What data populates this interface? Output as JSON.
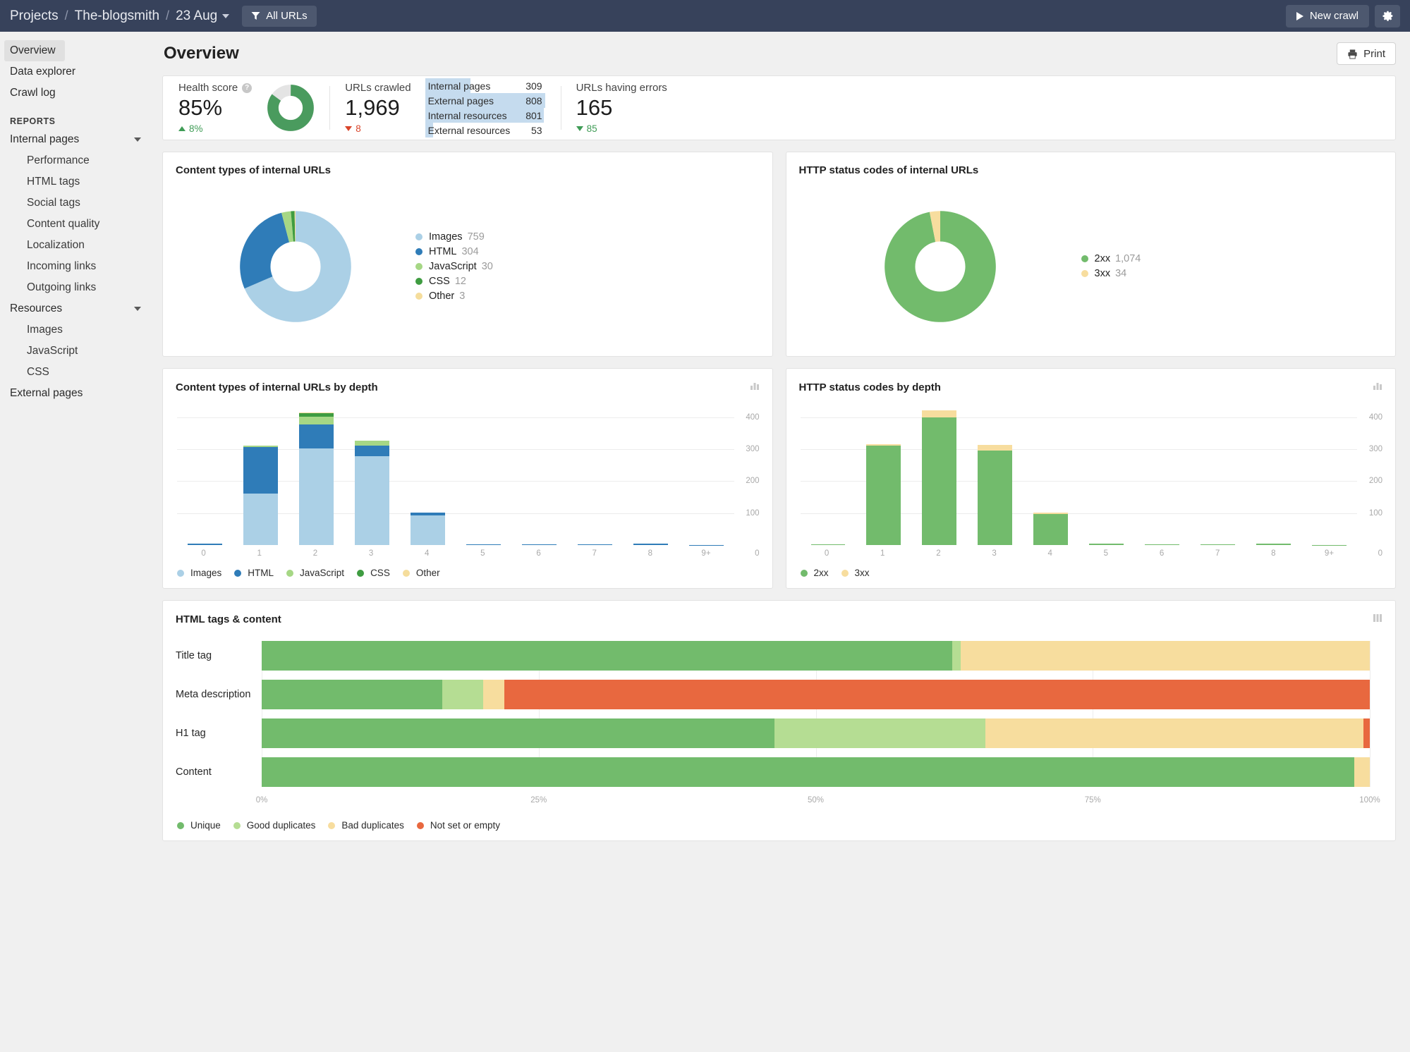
{
  "topbar": {
    "breadcrumbs": [
      "Projects",
      "The-blogsmith",
      "23 Aug"
    ],
    "filter_label": "All URLs",
    "new_crawl_label": "New crawl",
    "settings_icon": "gear-icon",
    "filter_icon": "funnel-icon",
    "play_icon": "play-icon"
  },
  "sidebar": {
    "top_items": [
      {
        "label": "Overview",
        "active": true
      },
      {
        "label": "Data explorer",
        "active": false
      },
      {
        "label": "Crawl log",
        "active": false
      }
    ],
    "section_label": "REPORTS",
    "groups": [
      {
        "label": "Internal pages",
        "expandable": true,
        "children": [
          {
            "label": "Performance"
          },
          {
            "label": "HTML tags"
          },
          {
            "label": "Social tags"
          },
          {
            "label": "Content quality"
          },
          {
            "label": "Localization"
          },
          {
            "label": "Incoming links"
          },
          {
            "label": "Outgoing links"
          }
        ]
      },
      {
        "label": "Resources",
        "expandable": true,
        "children": [
          {
            "label": "Images"
          },
          {
            "label": "JavaScript"
          },
          {
            "label": "CSS"
          }
        ]
      }
    ],
    "bottom_items": [
      {
        "label": "External pages"
      }
    ]
  },
  "page": {
    "title": "Overview",
    "print_label": "Print",
    "print_icon": "printer-icon"
  },
  "kpis": {
    "health": {
      "label": "Health score",
      "help_icon": "question-mark-icon",
      "value": "85%",
      "delta": "8%",
      "delta_dir": "up",
      "percent": 85,
      "color": "#4a9b5e",
      "track": "#e4e4e4"
    },
    "crawled": {
      "label": "URLs crawled",
      "value": "1,969",
      "delta": "8",
      "delta_dir": "down",
      "breakdown": [
        {
          "label": "Internal pages",
          "value": "309",
          "pct": 38
        },
        {
          "label": "External pages",
          "value": "808",
          "pct": 100
        },
        {
          "label": "Internal resources",
          "value": "801",
          "pct": 99
        },
        {
          "label": "External resources",
          "value": "53",
          "pct": 7
        }
      ],
      "bar_color": "#c5dbee"
    },
    "errors": {
      "label": "URLs having errors",
      "value": "165",
      "delta": "85",
      "delta_dir": "down-good"
    }
  },
  "chart_data": [
    {
      "id": "content-types-donut",
      "type": "pie",
      "title": "Content types of internal URLs",
      "categories": [
        "Images",
        "HTML",
        "JavaScript",
        "CSS",
        "Other"
      ],
      "values": [
        759,
        304,
        30,
        12,
        3
      ],
      "colors": [
        "#abd0e6",
        "#2f7cb8",
        "#a6d785",
        "#3f9c41",
        "#f5dd9c"
      ],
      "legend_position": "right",
      "donut": true
    },
    {
      "id": "http-status-donut",
      "type": "pie",
      "title": "HTTP status codes of internal URLs",
      "categories": [
        "2xx",
        "3xx"
      ],
      "values": [
        1074,
        34
      ],
      "value_labels": [
        "1,074",
        "34"
      ],
      "colors": [
        "#72bb6c",
        "#f7dd9e"
      ],
      "legend_position": "right",
      "donut": true
    },
    {
      "id": "content-types-by-depth",
      "type": "bar",
      "title": "Content types of internal URLs by depth",
      "stacked": true,
      "categories": [
        "0",
        "1",
        "2",
        "3",
        "4",
        "5",
        "6",
        "7",
        "8",
        "9+"
      ],
      "series": [
        {
          "name": "Images",
          "color": "#abd0e6",
          "values": [
            0,
            160,
            302,
            277,
            92,
            0,
            0,
            0,
            0,
            0
          ]
        },
        {
          "name": "HTML",
          "color": "#2f7cb8",
          "values": [
            4,
            146,
            76,
            35,
            9,
            3,
            3,
            3,
            4,
            1
          ]
        },
        {
          "name": "JavaScript",
          "color": "#a6d785",
          "values": [
            0,
            5,
            24,
            14,
            0,
            0,
            0,
            0,
            0,
            0
          ]
        },
        {
          "name": "CSS",
          "color": "#3f9c41",
          "values": [
            0,
            0,
            11,
            0,
            0,
            0,
            0,
            0,
            0,
            0
          ]
        },
        {
          "name": "Other",
          "color": "#f5dd9c",
          "values": [
            0,
            0,
            2,
            0,
            0,
            0,
            0,
            0,
            0,
            0
          ]
        }
      ],
      "xlabel": "",
      "ylabel": "",
      "yticks": [
        0,
        100,
        200,
        300,
        400
      ],
      "ylim": [
        0,
        430
      ],
      "grid": true,
      "legend_position": "bottom",
      "card_icon": "bar-chart-icon"
    },
    {
      "id": "http-status-by-depth",
      "type": "bar",
      "title": "HTTP status codes by depth",
      "stacked": true,
      "categories": [
        "0",
        "1",
        "2",
        "3",
        "4",
        "5",
        "6",
        "7",
        "8",
        "9+"
      ],
      "series": [
        {
          "name": "2xx",
          "color": "#72bb6c",
          "values": [
            3,
            310,
            400,
            296,
            96,
            4,
            2,
            2,
            5,
            1
          ]
        },
        {
          "name": "3xx",
          "color": "#f7dd9e",
          "values": [
            0,
            6,
            22,
            17,
            5,
            0,
            0,
            0,
            0,
            0
          ]
        }
      ],
      "xlabel": "",
      "ylabel": "",
      "yticks": [
        0,
        100,
        200,
        300,
        400
      ],
      "ylim": [
        0,
        430
      ],
      "grid": true,
      "legend_position": "bottom",
      "card_icon": "bar-chart-icon"
    },
    {
      "id": "html-tags-content",
      "type": "bar",
      "orientation": "horizontal",
      "stacked": true,
      "title": "HTML tags & content",
      "card_icon": "stacked-bar-icon",
      "categories": [
        "Title tag",
        "Meta description",
        "H1 tag",
        "Content"
      ],
      "series": [
        {
          "name": "Unique",
          "color": "#72bb6c",
          "values": [
            62.3,
            16.3,
            46.3,
            98.6
          ]
        },
        {
          "name": "Good duplicates",
          "color": "#b5dd93",
          "values": [
            0.8,
            3.7,
            19.0,
            0.0
          ]
        },
        {
          "name": "Bad duplicates",
          "color": "#f7dd9e",
          "values": [
            36.9,
            1.9,
            34.1,
            1.4
          ]
        },
        {
          "name": "Not set or empty",
          "color": "#e8683f",
          "values": [
            0.0,
            78.1,
            0.6,
            0.0
          ]
        }
      ],
      "xticks": [
        "0%",
        "25%",
        "50%",
        "75%",
        "100%"
      ],
      "xlim": [
        0,
        100
      ],
      "grid": true,
      "legend_position": "bottom"
    }
  ]
}
